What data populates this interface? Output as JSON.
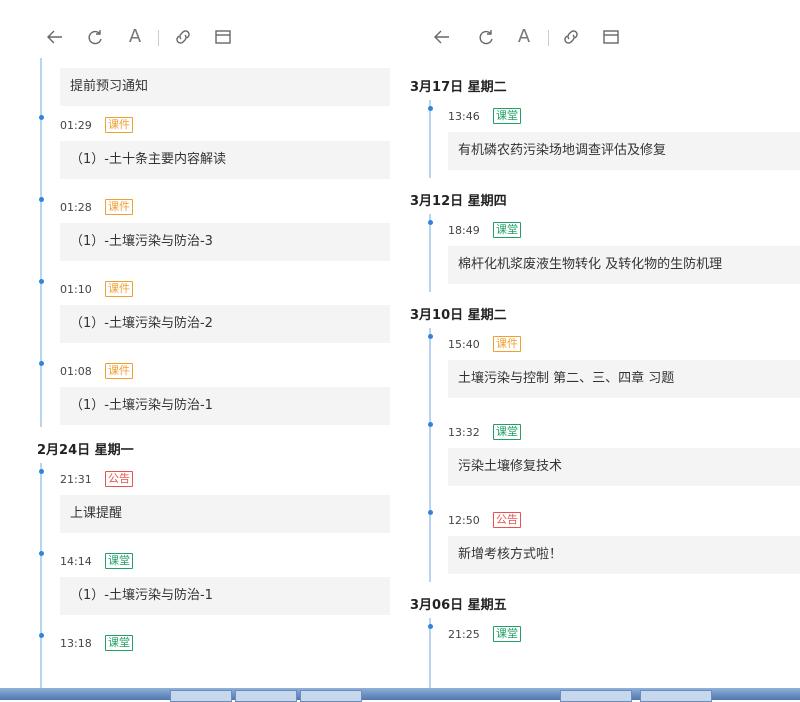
{
  "toolbar": {
    "icons": [
      "back-arrow-icon",
      "refresh-icon",
      "font-a-icon",
      "link-icon",
      "window-icon"
    ],
    "font_label": "A"
  },
  "left": {
    "feed": [
      {
        "kind": "card",
        "title": "提前预习通知"
      },
      {
        "kind": "entry",
        "time": "01:29",
        "tag": "课件",
        "tag_type": "course",
        "title": "（1）-土十条主要内容解读"
      },
      {
        "kind": "entry",
        "time": "01:28",
        "tag": "课件",
        "tag_type": "course",
        "title": "（1）-土壤污染与防治-3"
      },
      {
        "kind": "entry",
        "time": "01:10",
        "tag": "课件",
        "tag_type": "course",
        "title": "（1）-土壤污染与防治-2"
      },
      {
        "kind": "entry",
        "time": "01:08",
        "tag": "课件",
        "tag_type": "course",
        "title": "（1）-土壤污染与防治-1"
      },
      {
        "kind": "date",
        "label": "2月24日  星期一"
      },
      {
        "kind": "entry",
        "time": "21:31",
        "tag": "公告",
        "tag_type": "notice",
        "title": "上课提醒"
      },
      {
        "kind": "entry",
        "time": "14:14",
        "tag": "课堂",
        "tag_type": "class",
        "title": "（1）-土壤污染与防治-1"
      },
      {
        "kind": "entry",
        "time": "13:18",
        "tag": "课堂",
        "tag_type": "class",
        "title": ""
      }
    ]
  },
  "right": {
    "feed": [
      {
        "kind": "date",
        "label": "3月17日  星期二"
      },
      {
        "kind": "entry",
        "time": "13:46",
        "tag": "课堂",
        "tag_type": "class",
        "title": "有机磷农药污染场地调查评估及修复"
      },
      {
        "kind": "date",
        "label": "3月12日  星期四"
      },
      {
        "kind": "entry",
        "time": "18:49",
        "tag": "课堂",
        "tag_type": "class",
        "title": "棉杆化机浆废液生物转化 及转化物的生防机理"
      },
      {
        "kind": "date",
        "label": "3月10日  星期二"
      },
      {
        "kind": "entry",
        "time": "15:40",
        "tag": "课件",
        "tag_type": "course",
        "title": "土壤污染与控制 第二、三、四章 习题"
      },
      {
        "kind": "entry",
        "time": "13:32",
        "tag": "课堂",
        "tag_type": "class",
        "title": "污染土壤修复技术"
      },
      {
        "kind": "entry",
        "time": "12:50",
        "tag": "公告",
        "tag_type": "notice",
        "title": "新增考核方式啦！"
      },
      {
        "kind": "date",
        "label": "3月06日  星期五"
      },
      {
        "kind": "entry",
        "time": "21:25",
        "tag": "课堂",
        "tag_type": "class",
        "title": ""
      }
    ]
  },
  "colors": {
    "course": "#f0a030",
    "class": "#21a065",
    "notice": "#e8534e",
    "dot": "#2f86d9",
    "line": "#b8d4ee",
    "card": "#f4f4f4"
  }
}
